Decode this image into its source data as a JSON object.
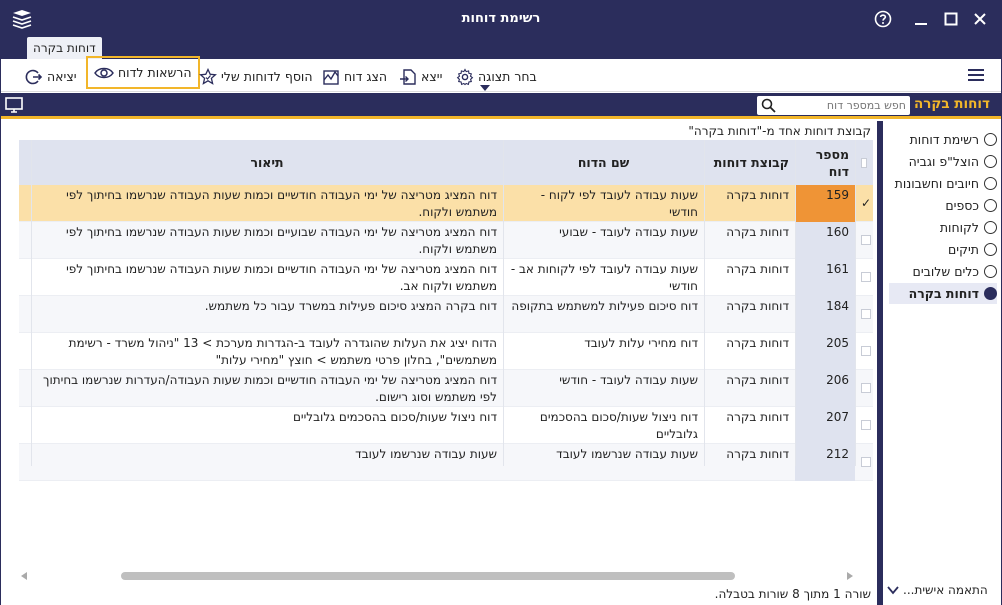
{
  "window": {
    "title": "רשימת דוחות"
  },
  "tabs": [
    {
      "label": "דוחות בקרה"
    }
  ],
  "toolbar": {
    "exit_label": "יציאה",
    "permissions_label": "הרשאות לדוח",
    "add_favorite_label": "הוסף לדוחות שלי",
    "show_report_label": "הצג דוח",
    "export_label": "ייצא",
    "choose_view_label": "בחר תצוגה"
  },
  "section": {
    "title": "דוחות בקרה",
    "search_placeholder": "חפש במספר דוח"
  },
  "main": {
    "group_info": "קבוצת דוחות אחד מ-\"דוחות בקרה\"",
    "status": "שורה 1 מתוך 8 שורות בטבלה."
  },
  "table": {
    "columns": {
      "num": "מספר דוח",
      "group": "קבוצת דוחות",
      "name": "שם הדוח",
      "desc": "תיאור"
    },
    "rows": [
      {
        "num": "159",
        "group": "דוחות בקרה",
        "name": "שעות עבודה לעובד לפי לקוח - חודשי",
        "desc": "דוח המציג מטריצה של ימי העבודה חודשיים וכמות שעות העבודה שנרשמו בחיתוך לפי משתמש ולקוח."
      },
      {
        "num": "160",
        "group": "דוחות בקרה",
        "name": "שעות עבודה לעובד - שבועי",
        "desc": "דוח המציג מטריצה של ימי העבודה שבועיים וכמות שעות העבודה שנרשמו בחיתוך לפי משתמש ולקוח."
      },
      {
        "num": "161",
        "group": "דוחות בקרה",
        "name": "שעות עבודה לעובד לפי לקוחות אב - חודשי",
        "desc": "דוח המציג מטריצה של ימי העבודה חודשיים וכמות שעות העבודה שנרשמו בחיתוך לפי משתמש ולקוח אב."
      },
      {
        "num": "184",
        "group": "דוחות בקרה",
        "name": "דוח סיכום פעילות למשתמש בתקופה",
        "desc": "דוח בקרה המציג סיכום פעילות במשרד עבור כל משתמש."
      },
      {
        "num": "205",
        "group": "דוחות בקרה",
        "name": "דוח מחירי עלות לעובד",
        "desc": "הדוח יציג את העלות שהוגדרה לעובד ב-הגדרות מערכת > 13 \"ניהול משרד - רשימת משתמשים\", בחלון פרטי משתמש > חוצץ \"מחירי עלות\""
      },
      {
        "num": "206",
        "group": "דוחות בקרה",
        "name": "שעות עבודה לעובד - חודשי",
        "desc": "דוח המציג מטריצה של ימי העבודה חודשיים וכמות שעות העבודה/העדרות שנרשמו בחיתוך לפי משתמש וסוג רישום."
      },
      {
        "num": "207",
        "group": "דוחות בקרה",
        "name": "דוח ניצול שעות/סכום בהסכמים גלובליים",
        "desc": "דוח ניצול שעות/סכום בהסכמים גלובליים"
      },
      {
        "num": "212",
        "group": "דוחות בקרה",
        "name": "שעות עבודה שנרשמו לעובד",
        "desc": "שעות עבודה שנרשמו לעובד"
      }
    ],
    "selected_index": 0
  },
  "sidebar": {
    "items": [
      {
        "label": "רשימת דוחות"
      },
      {
        "label": "הוצל\"פ וגביה"
      },
      {
        "label": "חיובים וחשבונות"
      },
      {
        "label": "כספים"
      },
      {
        "label": "לקוחות"
      },
      {
        "label": "תיקים"
      },
      {
        "label": "כלים שלובים"
      },
      {
        "label": "דוחות בקרה"
      }
    ],
    "active_index": 7,
    "personal_label": "התאמה אישית..."
  },
  "colors": {
    "brand_navy": "#2b2d5c",
    "accent_yellow": "#f2b62a",
    "selected_row": "#fbe0a8",
    "selected_num": "#ef9436"
  },
  "icons": [
    "app-logo-icon",
    "help-icon",
    "minimize-icon",
    "maximize-icon",
    "close-icon",
    "hamburger-menu-icon",
    "exit-icon",
    "eye-icon",
    "star-icon",
    "chart-icon",
    "export-icon",
    "gear-icon",
    "search-icon",
    "monitor-icon",
    "chevron-down-icon",
    "checkmark-icon"
  ]
}
